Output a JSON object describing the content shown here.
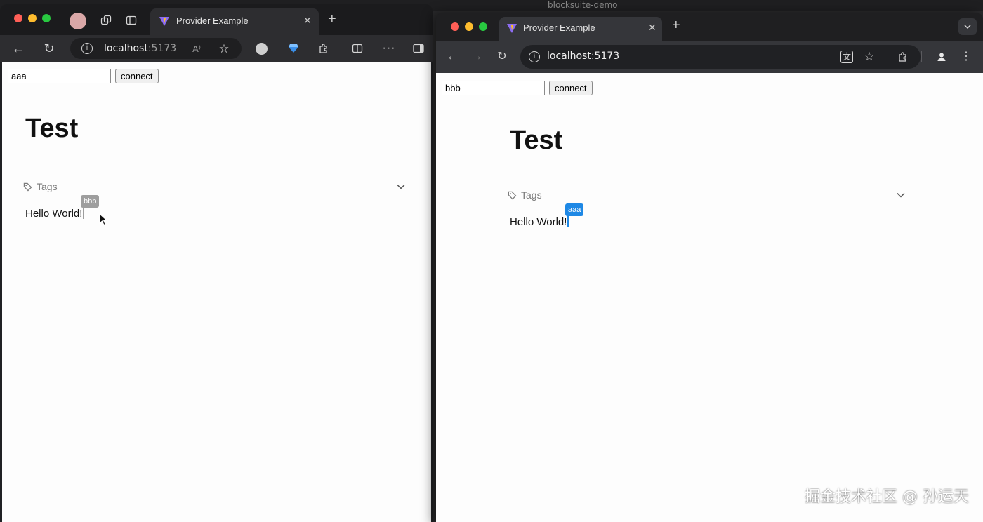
{
  "desktop": {
    "menubar_title": "blocksuite-demo"
  },
  "left_window": {
    "browser": "edge",
    "tab": {
      "title": "Provider Example"
    },
    "address_bar": {
      "host": "localhost",
      "port": ":5173"
    },
    "toolbar_icons": [
      "back-icon",
      "refresh-icon",
      "info-icon",
      "read-aloud-icon",
      "favorite-icon",
      "extension-globe-icon",
      "extension-gem-icon",
      "extensions-icon",
      "split-screen-icon",
      "more-icon",
      "sidebar-icon"
    ],
    "page": {
      "name_input_value": "aaa",
      "connect_label": "connect",
      "doc_title": "Test",
      "tags_label": "Tags",
      "paragraph": "Hello World!",
      "remote_cursor": {
        "label": "bbb",
        "color": "#9e9e9e"
      }
    }
  },
  "right_window": {
    "browser": "chrome",
    "tab": {
      "title": "Provider Example"
    },
    "address_bar": {
      "url": "localhost:5173"
    },
    "page": {
      "name_input_value": "bbb",
      "connect_label": "connect",
      "doc_title": "Test",
      "tags_label": "Tags",
      "paragraph": "Hello World!",
      "remote_cursor": {
        "label": "aaa",
        "color": "#1e88e5"
      }
    }
  },
  "watermark": "掘金技术社区 @ 孙运天"
}
